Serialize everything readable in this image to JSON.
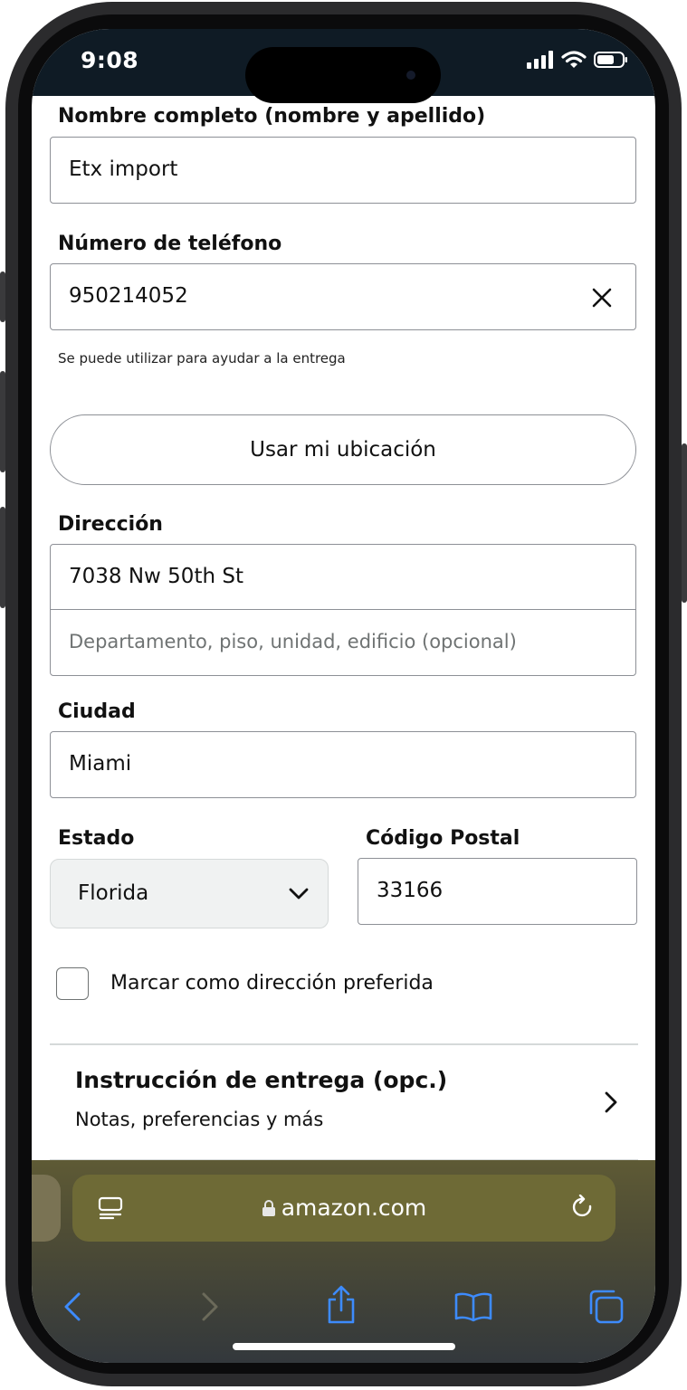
{
  "status_bar": {
    "time": "9:08"
  },
  "form": {
    "full_name": {
      "label": "Nombre completo (nombre y apellido)",
      "value": "Etx import"
    },
    "phone": {
      "label": "Número de teléfono",
      "value": "950214052",
      "hint": "Se puede utilizar para ayudar a la entrega"
    },
    "use_location_button": "Usar mi ubicación",
    "address": {
      "label": "Dirección",
      "line1": "7038 Nw 50th St",
      "line2_placeholder": "Departamento, piso, unidad, edificio (opcional)"
    },
    "city": {
      "label": "Ciudad",
      "value": "Miami"
    },
    "state": {
      "label": "Estado",
      "value": "Florida"
    },
    "postal_code": {
      "label": "Código Postal",
      "value": "33166"
    },
    "preferred_checkbox": {
      "label": "Marcar como dirección preferida",
      "checked": false
    },
    "delivery_instructions": {
      "title": "Instrucción de entrega (opc.)",
      "subtitle": "Notas, preferencias y más"
    }
  },
  "browser": {
    "url": "amazon.com"
  },
  "colors": {
    "accent": "#3d8bfd",
    "status_bar_bg": "#0f1b25",
    "toolbar_tint": "#6e6a36"
  }
}
